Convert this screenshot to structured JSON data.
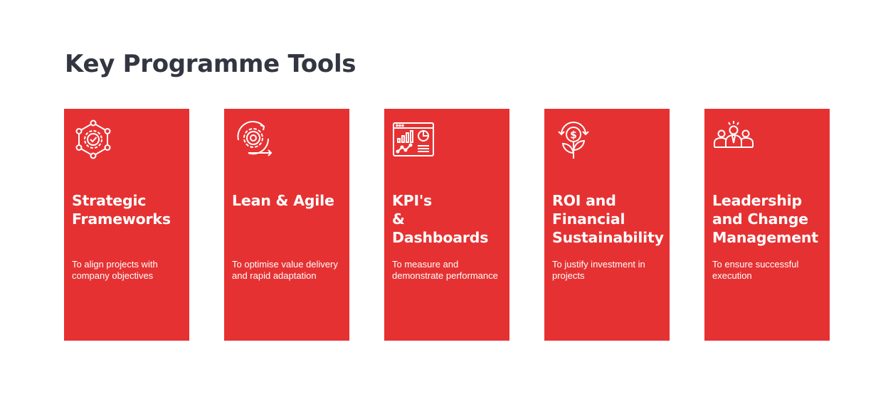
{
  "page": {
    "title": "Key Programme Tools"
  },
  "theme": {
    "card_color": "#e63132",
    "title_color": "#333640"
  },
  "cards": [
    {
      "icon": "gear-network-icon",
      "title": "Strategic\nFrameworks",
      "description": "To align projects with company objectives"
    },
    {
      "icon": "gear-cycle-icon",
      "title": "Lean & Agile",
      "description": "To optimise value delivery and rapid adaptation"
    },
    {
      "icon": "dashboard-icon",
      "title": "KPI's\n& Dashboards",
      "description": "To measure and demonstrate performance"
    },
    {
      "icon": "money-plant-icon",
      "title": "ROI and\nFinancial\nSustainability",
      "description": "To justify investment in projects"
    },
    {
      "icon": "team-leader-icon",
      "title": "Leadership\nand Change\nManagement",
      "description": "To ensure successful execution"
    }
  ]
}
